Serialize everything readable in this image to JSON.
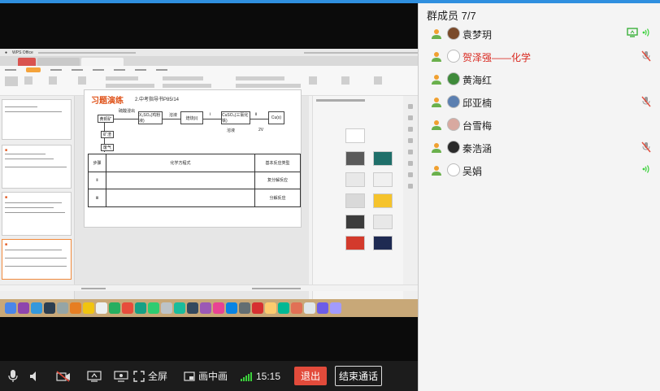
{
  "members_panel": {
    "title": "群成员 7/7",
    "members": [
      {
        "name": "袁梦玥",
        "teacher": false,
        "muted": false,
        "sharing": true,
        "speaking": true,
        "avatar_color": "#7a4a2a"
      },
      {
        "name": "贺泽强——化学",
        "teacher": true,
        "muted": true,
        "sharing": false,
        "speaking": false,
        "avatar_color": "#ffffff"
      },
      {
        "name": "黄海红",
        "teacher": false,
        "muted": false,
        "sharing": false,
        "speaking": false,
        "avatar_color": "#3e8a3a"
      },
      {
        "name": "邱亚楠",
        "teacher": false,
        "muted": true,
        "sharing": false,
        "speaking": false,
        "avatar_color": "#5b7fb0"
      },
      {
        "name": "台雪梅",
        "teacher": false,
        "muted": false,
        "sharing": false,
        "speaking": false,
        "avatar_color": "#d8a9a0"
      },
      {
        "name": "秦浩涵",
        "teacher": false,
        "muted": true,
        "sharing": false,
        "speaking": false,
        "avatar_color": "#2a2a2a"
      },
      {
        "name": "吴娟",
        "teacher": false,
        "muted": false,
        "sharing": false,
        "speaking": true,
        "avatar_color": "#ffffff"
      }
    ]
  },
  "controls": {
    "fullscreen_label": "全屏",
    "pip_label": "画中画",
    "time": "15:15",
    "quit_label": "退出",
    "end_call_label": "结束通话"
  },
  "colors": {
    "accent_green": "#3bd13b",
    "quit_red": "#e24b3b",
    "teacher_red": "#d9281f",
    "topbar_blue": "#2f8fdf"
  },
  "shared_screen": {
    "app_name": "WPS Office",
    "slide": {
      "title": "习题演练",
      "subtitle": "2.中考指导书P85/14",
      "flow_boxes": [
        "黄铜矿",
        "X₂SO₄(鸡粉液)",
        "焙烧(Ⅰ)",
        "CuSO₄(三氯化铁)",
        "Cu(s)",
        "矿渣",
        "废气"
      ],
      "flow_labels": [
        "硫酸浸出",
        "溶液",
        "Ⅰ",
        "Ⅱ",
        "2V",
        "溶液"
      ],
      "table": {
        "headers": [
          "步骤",
          "化学方程式",
          "基本反应类型"
        ],
        "rows": [
          [
            "Ⅱ",
            "",
            "复分解反应"
          ],
          [
            "Ⅲ",
            "",
            "分解反应"
          ]
        ]
      }
    }
  }
}
